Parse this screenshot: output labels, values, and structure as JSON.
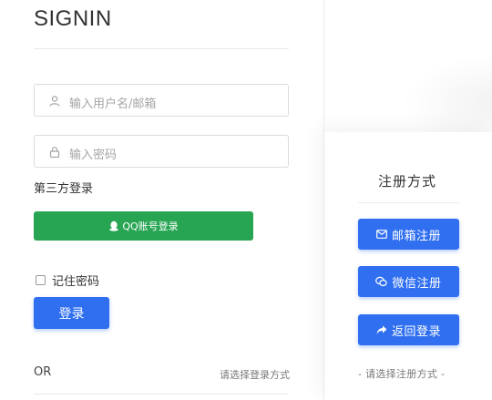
{
  "signin": {
    "title": "SIGNIN",
    "username_placeholder": "输入用户名/邮箱",
    "password_placeholder": "输入密码",
    "third_party_label": "第三方登录",
    "qq_button": "QQ账号登录",
    "remember_label": "记住密码",
    "login_button": "登录",
    "or_text": "OR",
    "choose_login_text": "请选择登录方式"
  },
  "register": {
    "title": "注册方式",
    "buttons": [
      {
        "label": "邮箱注册",
        "icon": "mail-icon"
      },
      {
        "label": "微信注册",
        "icon": "wechat-icon"
      },
      {
        "label": "返回登录",
        "icon": "share-arrow-icon"
      }
    ],
    "footer": "- 请选择注册方式 -"
  },
  "colors": {
    "primary": "#2f6ff0",
    "qq_green": "#27a553"
  }
}
